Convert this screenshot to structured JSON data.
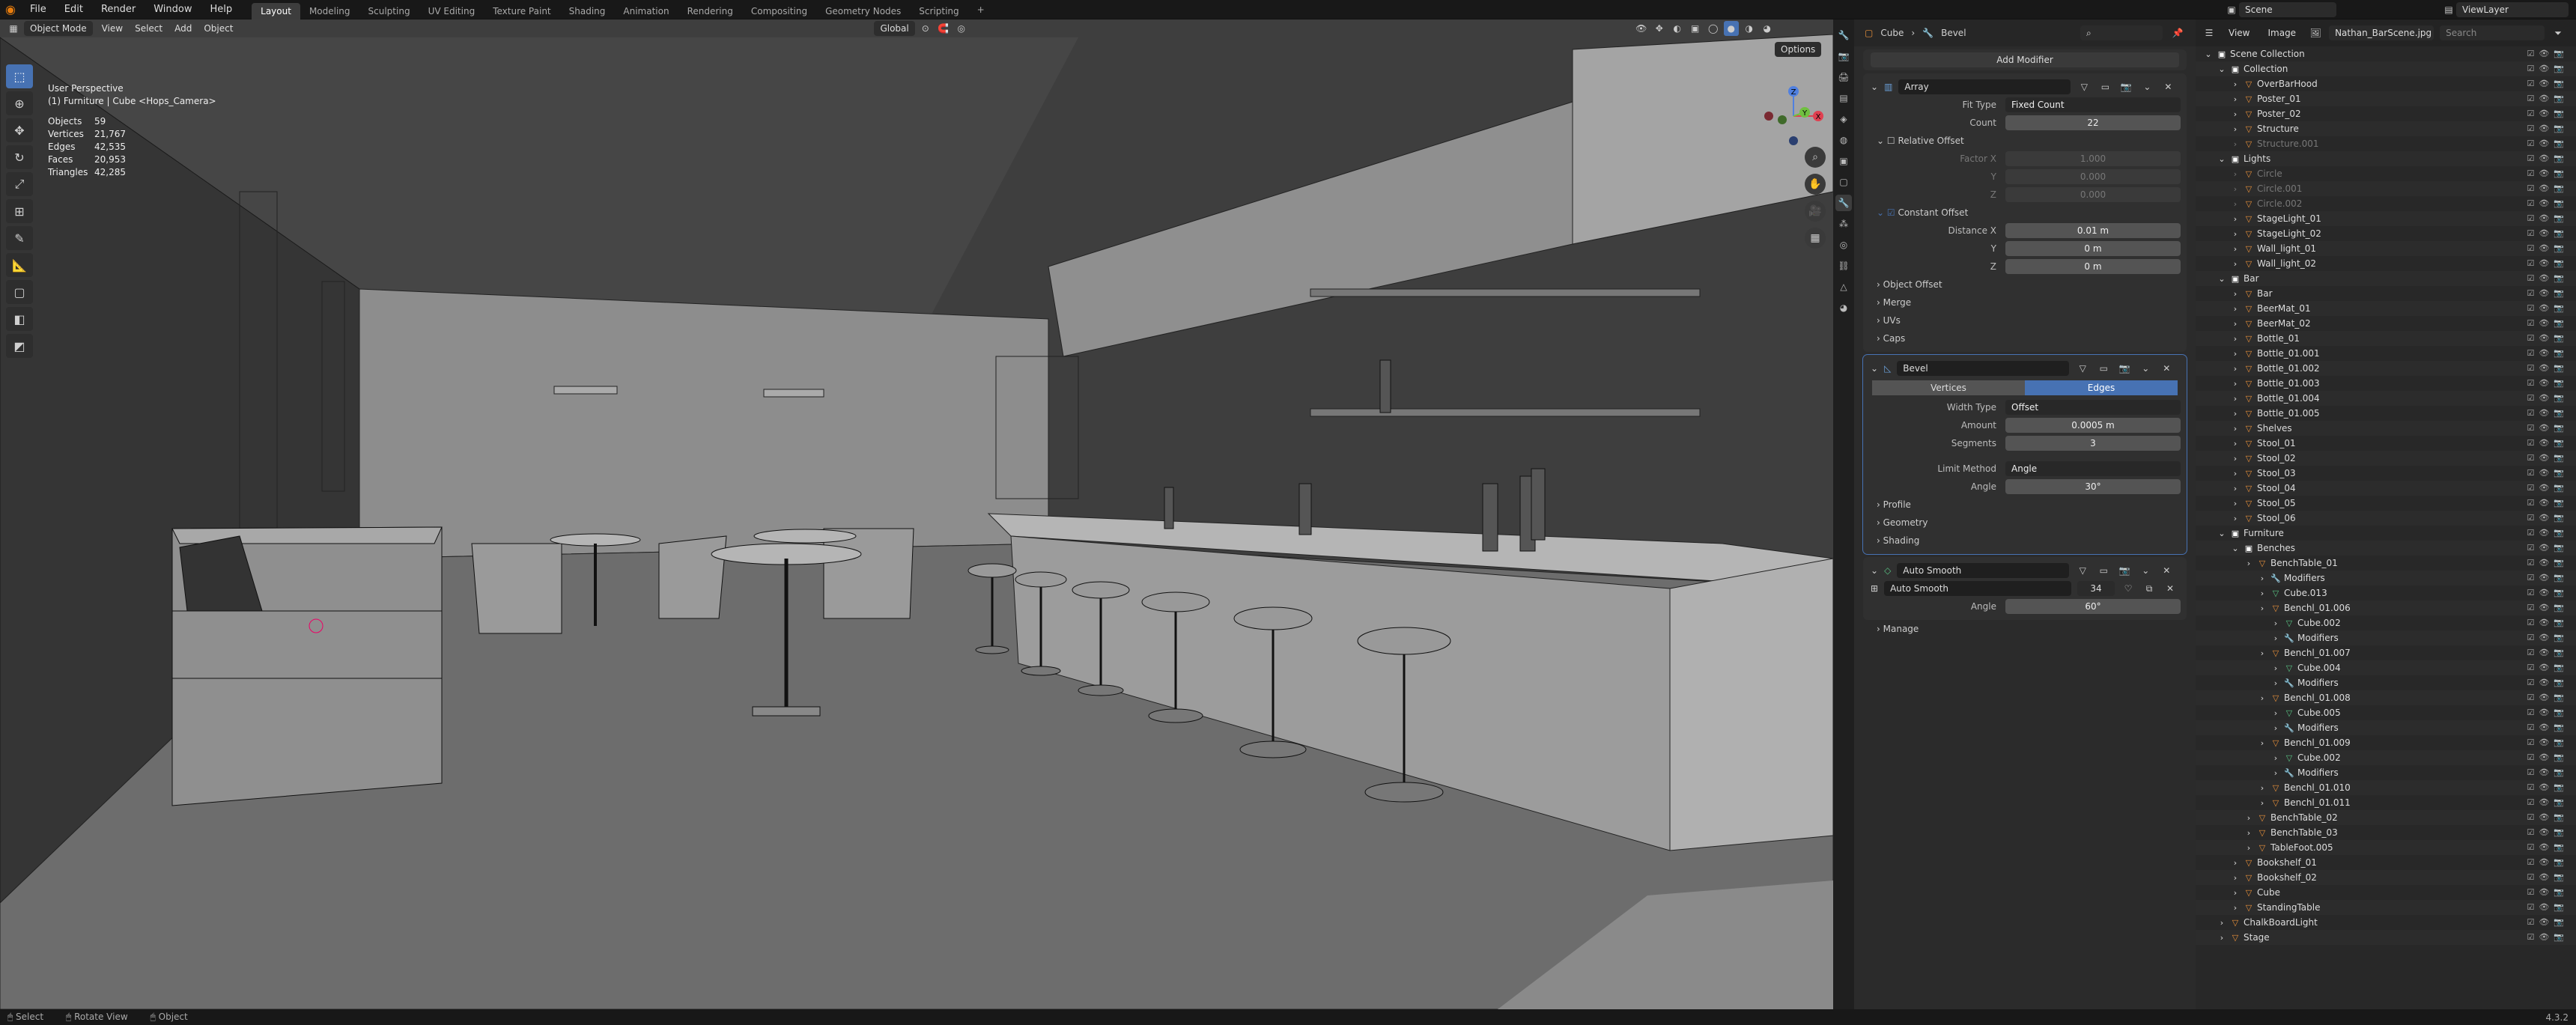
{
  "topbar": {
    "menu": [
      "File",
      "Edit",
      "Render",
      "Window",
      "Help"
    ],
    "workspaces": [
      "Layout",
      "Modeling",
      "Sculpting",
      "UV Editing",
      "Texture Paint",
      "Shading",
      "Animation",
      "Rendering",
      "Compositing",
      "Geometry Nodes",
      "Scripting"
    ],
    "active_workspace": "Layout",
    "add_workspace": "+",
    "scene_label": "Scene",
    "view_layer": "ViewLayer"
  },
  "viewport": {
    "mode": "Object Mode",
    "menus": [
      "View",
      "Select",
      "Add",
      "Object"
    ],
    "transform": "Global",
    "options": "Options",
    "perspective": "User Perspective",
    "context": "(1) Furniture | Cube <Hops_Camera>",
    "stats": [
      {
        "k": "Objects",
        "v": "59"
      },
      {
        "k": "Vertices",
        "v": "21,767"
      },
      {
        "k": "Edges",
        "v": "42,535"
      },
      {
        "k": "Faces",
        "v": "20,953"
      },
      {
        "k": "Triangles",
        "v": "42,285"
      }
    ],
    "gizmo_axes": {
      "x": "X",
      "y": "Y",
      "z": "Z"
    }
  },
  "properties": {
    "breadcrumb_object": "Cube",
    "breadcrumb_mod": "Bevel",
    "add_modifier": "Add Modifier",
    "array": {
      "name": "Array",
      "fit_type_label": "Fit Type",
      "fit_type": "Fixed Count",
      "count_label": "Count",
      "count": "22",
      "relative_offset": "Relative Offset",
      "factor_x_label": "Factor X",
      "factor_x": "1.000",
      "y_label": "Y",
      "y": "0.000",
      "z_label": "Z",
      "z": "0.000",
      "constant_offset": "Constant Offset",
      "distance_x_label": "Distance X",
      "distance_x": "0.01 m",
      "dy_label": "Y",
      "dy": "0 m",
      "dz_label": "Z",
      "dz": "0 m",
      "subpanels": [
        "Object Offset",
        "Merge",
        "UVs",
        "Caps"
      ]
    },
    "bevel": {
      "name": "Bevel",
      "seg_vertices": "Vertices",
      "seg_edges": "Edges",
      "width_type_label": "Width Type",
      "width_type": "Offset",
      "amount_label": "Amount",
      "amount": "0.0005 m",
      "segments_label": "Segments",
      "segments": "3",
      "limit_method_label": "Limit Method",
      "limit_method": "Angle",
      "angle_label": "Angle",
      "angle": "30°",
      "subpanels": [
        "Profile",
        "Geometry",
        "Shading"
      ]
    },
    "auto_smooth": {
      "name": "Auto Smooth",
      "node_name": "Auto Smooth",
      "node_users": "34",
      "angle_label": "Angle",
      "angle": "60°"
    },
    "manage": "Manage"
  },
  "outliner": {
    "header_menus": [
      "View",
      "Image"
    ],
    "image_name": "Nathan_BarScene.jpg",
    "search_placeholder": "Search",
    "rows": [
      {
        "label": "Scene Collection",
        "indent": 0,
        "icon": "collection",
        "dim": false
      },
      {
        "label": "Collection",
        "indent": 1,
        "icon": "collection",
        "dim": false
      },
      {
        "label": "OverBarHood",
        "indent": 2,
        "icon": "object",
        "dim": false
      },
      {
        "label": "Poster_01",
        "indent": 2,
        "icon": "object",
        "dim": false
      },
      {
        "label": "Poster_02",
        "indent": 2,
        "icon": "object",
        "dim": false
      },
      {
        "label": "Structure",
        "indent": 2,
        "icon": "object",
        "dim": false
      },
      {
        "label": "Structure.001",
        "indent": 2,
        "icon": "object",
        "dim": true
      },
      {
        "label": "Lights",
        "indent": 1,
        "icon": "collection",
        "dim": false
      },
      {
        "label": "Circle",
        "indent": 2,
        "icon": "object",
        "dim": true
      },
      {
        "label": "Circle.001",
        "indent": 2,
        "icon": "object",
        "dim": true
      },
      {
        "label": "Circle.002",
        "indent": 2,
        "icon": "object",
        "dim": true
      },
      {
        "label": "StageLight_01",
        "indent": 2,
        "icon": "object",
        "dim": false
      },
      {
        "label": "StageLight_02",
        "indent": 2,
        "icon": "object",
        "dim": false
      },
      {
        "label": "Wall_light_01",
        "indent": 2,
        "icon": "object",
        "dim": false
      },
      {
        "label": "Wall_light_02",
        "indent": 2,
        "icon": "object",
        "dim": false
      },
      {
        "label": "Bar",
        "indent": 1,
        "icon": "collection",
        "dim": false
      },
      {
        "label": "Bar",
        "indent": 2,
        "icon": "object",
        "dim": false
      },
      {
        "label": "BeerMat_01",
        "indent": 2,
        "icon": "object",
        "dim": false
      },
      {
        "label": "BeerMat_02",
        "indent": 2,
        "icon": "object",
        "dim": false
      },
      {
        "label": "Bottle_01",
        "indent": 2,
        "icon": "object",
        "dim": false
      },
      {
        "label": "Bottle_01.001",
        "indent": 2,
        "icon": "object",
        "dim": false
      },
      {
        "label": "Bottle_01.002",
        "indent": 2,
        "icon": "object",
        "dim": false
      },
      {
        "label": "Bottle_01.003",
        "indent": 2,
        "icon": "object",
        "dim": false
      },
      {
        "label": "Bottle_01.004",
        "indent": 2,
        "icon": "object",
        "dim": false
      },
      {
        "label": "Bottle_01.005",
        "indent": 2,
        "icon": "object",
        "dim": false
      },
      {
        "label": "Shelves",
        "indent": 2,
        "icon": "object",
        "dim": false
      },
      {
        "label": "Stool_01",
        "indent": 2,
        "icon": "object",
        "dim": false
      },
      {
        "label": "Stool_02",
        "indent": 2,
        "icon": "object",
        "dim": false
      },
      {
        "label": "Stool_03",
        "indent": 2,
        "icon": "object",
        "dim": false
      },
      {
        "label": "Stool_04",
        "indent": 2,
        "icon": "object",
        "dim": false
      },
      {
        "label": "Stool_05",
        "indent": 2,
        "icon": "object",
        "dim": false
      },
      {
        "label": "Stool_06",
        "indent": 2,
        "icon": "object",
        "dim": false
      },
      {
        "label": "Furniture",
        "indent": 1,
        "icon": "collection",
        "dim": false
      },
      {
        "label": "Benches",
        "indent": 2,
        "icon": "collection",
        "dim": false
      },
      {
        "label": "BenchTable_01",
        "indent": 3,
        "icon": "object",
        "dim": false
      },
      {
        "label": "Modifiers",
        "indent": 4,
        "icon": "wrench",
        "dim": false
      },
      {
        "label": "Cube.013",
        "indent": 4,
        "icon": "mesh",
        "dim": false
      },
      {
        "label": "Benchl_01.006",
        "indent": 4,
        "icon": "object",
        "dim": false
      },
      {
        "label": "Cube.002",
        "indent": 5,
        "icon": "mesh",
        "dim": false
      },
      {
        "label": "Modifiers",
        "indent": 5,
        "icon": "wrench",
        "dim": false
      },
      {
        "label": "Benchl_01.007",
        "indent": 4,
        "icon": "object",
        "dim": false
      },
      {
        "label": "Cube.004",
        "indent": 5,
        "icon": "mesh",
        "dim": false
      },
      {
        "label": "Modifiers",
        "indent": 5,
        "icon": "wrench",
        "dim": false
      },
      {
        "label": "Benchl_01.008",
        "indent": 4,
        "icon": "object",
        "dim": false
      },
      {
        "label": "Cube.005",
        "indent": 5,
        "icon": "mesh",
        "dim": false
      },
      {
        "label": "Modifiers",
        "indent": 5,
        "icon": "wrench",
        "dim": false
      },
      {
        "label": "Benchl_01.009",
        "indent": 4,
        "icon": "object",
        "dim": false
      },
      {
        "label": "Cube.002",
        "indent": 5,
        "icon": "mesh",
        "dim": false
      },
      {
        "label": "Modifiers",
        "indent": 5,
        "icon": "wrench",
        "dim": false
      },
      {
        "label": "Benchl_01.010",
        "indent": 4,
        "icon": "object",
        "dim": false
      },
      {
        "label": "Benchl_01.011",
        "indent": 4,
        "icon": "object",
        "dim": false
      },
      {
        "label": "BenchTable_02",
        "indent": 3,
        "icon": "object",
        "dim": false
      },
      {
        "label": "BenchTable_03",
        "indent": 3,
        "icon": "object",
        "dim": false
      },
      {
        "label": "TableFoot.005",
        "indent": 3,
        "icon": "object",
        "dim": false
      },
      {
        "label": "Bookshelf_01",
        "indent": 2,
        "icon": "object",
        "dim": false
      },
      {
        "label": "Bookshelf_02",
        "indent": 2,
        "icon": "object",
        "dim": false
      },
      {
        "label": "Cube",
        "indent": 2,
        "icon": "object",
        "dim": false
      },
      {
        "label": "StandingTable",
        "indent": 2,
        "icon": "object",
        "dim": false
      },
      {
        "label": "ChalkBoardLight",
        "indent": 1,
        "icon": "object",
        "dim": false
      },
      {
        "label": "Stage",
        "indent": 1,
        "icon": "object",
        "dim": false
      }
    ]
  },
  "statusbar": {
    "items": [
      "Select",
      "Rotate View",
      "Object"
    ],
    "version": "4.3.2"
  }
}
